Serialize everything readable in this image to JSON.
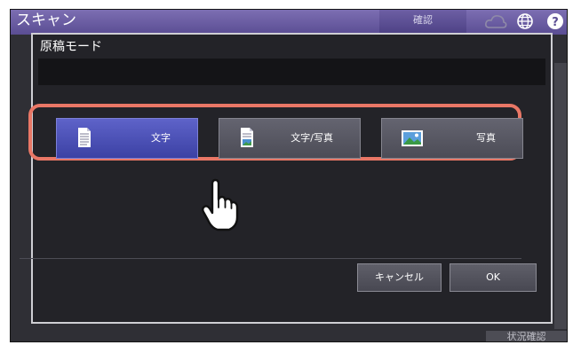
{
  "app": {
    "title": "スキャン",
    "confirm_tab": "確認",
    "status_button": "状況確認"
  },
  "dialog": {
    "title": "原稿モード",
    "modes": [
      {
        "label": "文字",
        "icon": "text-document-icon",
        "selected": true
      },
      {
        "label": "文字/写真",
        "icon": "text-photo-document-icon",
        "selected": false
      },
      {
        "label": "写真",
        "icon": "photo-icon",
        "selected": false
      }
    ],
    "cancel_label": "キャンセル",
    "ok_label": "OK"
  },
  "colors": {
    "selected_button": "#4b50b8",
    "highlight_frame": "#e97766",
    "title_bar": "#6b5ea8"
  },
  "icons": [
    "cloud-icon",
    "globe-icon",
    "help-icon",
    "pointing-hand-icon"
  ]
}
